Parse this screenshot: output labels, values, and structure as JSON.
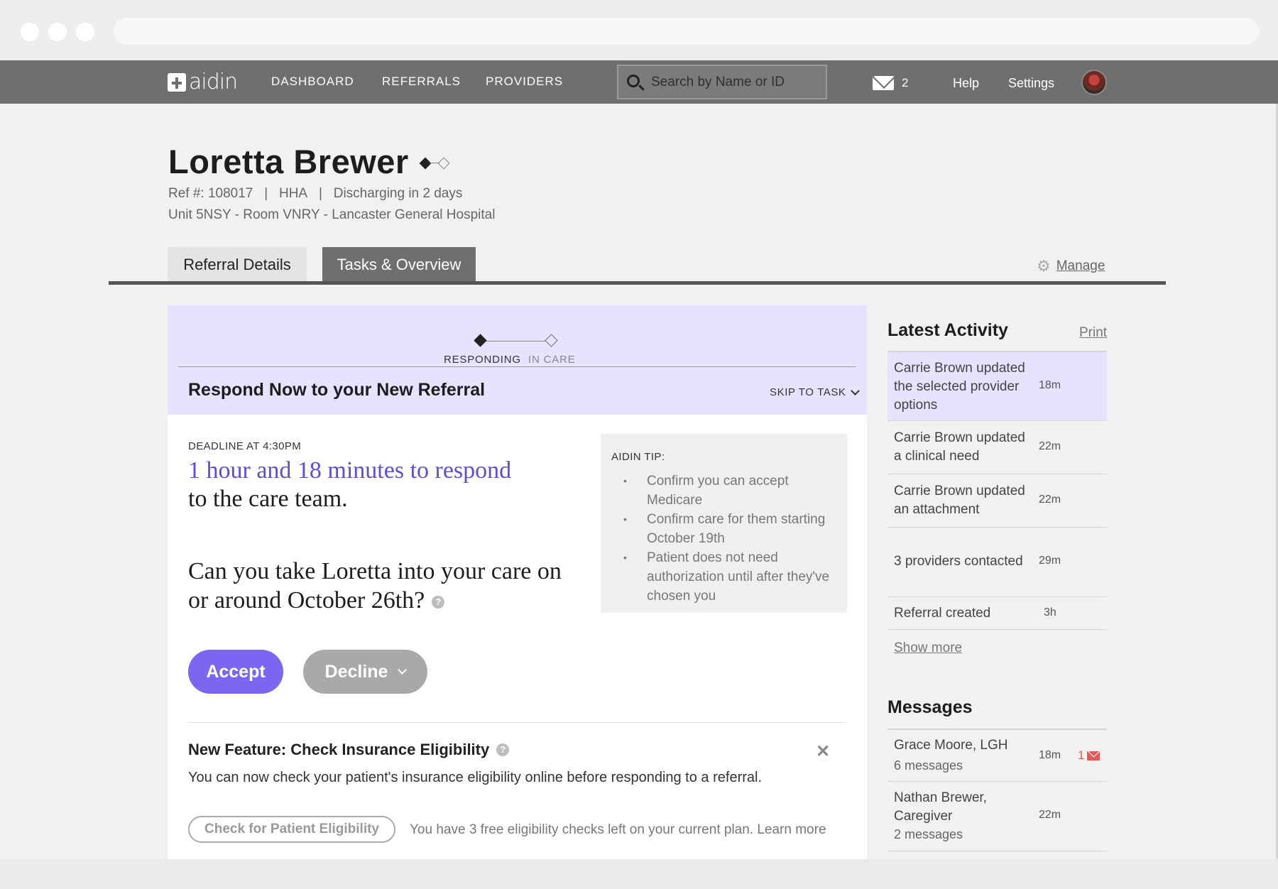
{
  "nav": {
    "logo": "aidin",
    "links": [
      "DASHBOARD",
      "REFERRALS",
      "PROVIDERS"
    ],
    "search_placeholder": "Search by Name or ID",
    "mail_count": "2",
    "help": "Help",
    "settings": "Settings"
  },
  "patient": {
    "name": "Loretta Brewer",
    "ref": "Ref #: 108017",
    "type": "HHA",
    "discharge": "Discharging in 2 days",
    "location": "Unit 5NSY - Room VNRY - Lancaster General Hospital"
  },
  "tabs": [
    "Referral Details",
    "Tasks & Overview"
  ],
  "manage": "Manage",
  "stepper": [
    "RESPONDING",
    "IN CARE"
  ],
  "task": {
    "title": "Respond Now to your New Referral",
    "skip": "SKIP TO TASK",
    "deadline": "DEADLINE AT 4:30PM",
    "countdown": "1 hour and 18 minutes to respond",
    "countdown_suffix": "to the care team.",
    "question": "Can you take Loretta into your care on or around October 26th?",
    "accept": "Accept",
    "decline": "Decline"
  },
  "tip": {
    "title": "AIDIN TIP:",
    "items": [
      "Confirm you can accept Medicare",
      "Confirm care for them starting October 19th",
      "Patient does not need authorization until after they've chosen you"
    ]
  },
  "feature": {
    "title": "New Feature: Check Insurance Eligibility",
    "desc": "You can now check your patient's insurance eligibility online before responding to a referral.",
    "button": "Check for Patient Eligibility",
    "note": "You have 3 free eligibility checks left on your current plan. Learn more"
  },
  "activity": {
    "title": "Latest Activity",
    "print": "Print",
    "items": [
      {
        "text": "Carrie Brown updated the selected provider options",
        "time": "18m"
      },
      {
        "text": "Carrie Brown updated a clinical need",
        "time": "22m"
      },
      {
        "text": "Carrie Brown updated an attachment",
        "time": "22m"
      },
      {
        "text": "3 providers contacted",
        "time": "29m"
      },
      {
        "text": "Referral created",
        "time": "3h"
      }
    ],
    "show_more": "Show more"
  },
  "messages": {
    "title": "Messages",
    "items": [
      {
        "name": "Grace Moore, LGH",
        "count": "6 messages",
        "time": "18m",
        "unread": "1"
      },
      {
        "name": "Nathan Brewer, Caregiver",
        "count": "2 messages",
        "time": "22m"
      }
    ]
  },
  "colors": {
    "nav_bg": "#6f6f6f",
    "accent": "#7a66f0",
    "countdown": "#5b4fd9",
    "panel_tint": "#e5e3ff",
    "unread": "#e15a5a"
  }
}
